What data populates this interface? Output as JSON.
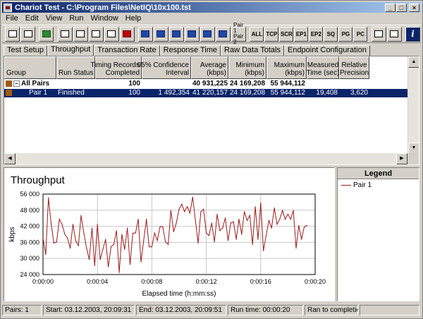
{
  "window": {
    "title": "Chariot Test - C:\\Program Files\\NetIQ\\10x100.tst"
  },
  "title_buttons": {
    "minimize": "_",
    "maximize": "□",
    "close": "×"
  },
  "menu": [
    "File",
    "Edit",
    "View",
    "Run",
    "Window",
    "Help"
  ],
  "toolbar": {
    "text_buttons": [
      "ALL",
      "TCP",
      "SCR",
      "EP1",
      "EP2",
      "SQ",
      "PG",
      "PC"
    ],
    "pair_label_1": "Pair 1",
    "pair_label_2": "Pair 2",
    "help": "i"
  },
  "tabs": [
    "Test Setup",
    "Throughput",
    "Transaction Rate",
    "Response Time",
    "Raw Data Totals",
    "Endpoint Configuration"
  ],
  "table": {
    "columns": [
      "Group",
      "Run Status",
      "Timing Records\nCompleted",
      "95% Confidence\nInterval",
      "Average\n(kbps)",
      "Minimum\n(kbps)",
      "Maximum\n(kbps)",
      "Measured\nTime (sec)",
      "Relative\nPrecision"
    ],
    "all_pairs": {
      "group": "All Pairs",
      "status": "",
      "records": "100",
      "confidence": "",
      "average": "40 931,225",
      "minimum": "24 169,208",
      "maximum": "55 944,112",
      "time": "",
      "precision": ""
    },
    "rows": [
      {
        "group": "Pair 1",
        "status": "Finished",
        "records": "100",
        "confidence": "1 492,354",
        "average": "41 220,157",
        "minimum": "24 169,208",
        "maximum": "55 944,112",
        "time": "19,408",
        "precision": "3,620"
      }
    ]
  },
  "chart_data": {
    "type": "line",
    "title": "Throughput",
    "xlabel": "Elapsed time (h:mm:ss)",
    "ylabel": "kbps",
    "xlim": [
      0,
      20
    ],
    "ylim": [
      24000,
      56000
    ],
    "xticks": [
      "0:00:00",
      "0:00:04",
      "0:00:08",
      "0:00:12",
      "0:00:16",
      "0:00:20"
    ],
    "yticks": [
      "24 000",
      "30 000",
      "36 000",
      "42 000",
      "48 000",
      "56 000"
    ],
    "grid": true,
    "series": [
      {
        "name": "Pair 1",
        "color": "#9b1b1b",
        "x": [
          0.0,
          0.2,
          0.4,
          0.6,
          0.8,
          1.0,
          1.2,
          1.4,
          1.6,
          1.8,
          2.0,
          2.2,
          2.4,
          2.6,
          2.8,
          3.0,
          3.2,
          3.4,
          3.6,
          3.8,
          4.0,
          4.2,
          4.4,
          4.6,
          4.8,
          5.0,
          5.2,
          5.4,
          5.6,
          5.8,
          6.0,
          6.2,
          6.4,
          6.6,
          6.8,
          7.0,
          7.2,
          7.4,
          7.6,
          7.8,
          8.0,
          8.2,
          8.4,
          8.6,
          8.8,
          9.0,
          9.2,
          9.4,
          9.6,
          9.8,
          10.0,
          10.2,
          10.4,
          10.6,
          10.8,
          11.0,
          11.2,
          11.4,
          11.6,
          11.8,
          12.0,
          12.2,
          12.4,
          12.6,
          12.8,
          13.0,
          13.2,
          13.4,
          13.6,
          13.8,
          14.0,
          14.2,
          14.4,
          14.6,
          14.8,
          15.0,
          15.2,
          15.4,
          15.6,
          15.8,
          16.0,
          16.2,
          16.4,
          16.6,
          16.8,
          17.0,
          17.2,
          17.4,
          17.6,
          17.8,
          18.0,
          18.2,
          18.4,
          18.6,
          18.8,
          19.0,
          19.2,
          19.4
        ],
        "values": [
          38500,
          32000,
          54500,
          44000,
          36500,
          37000,
          46000,
          44000,
          40000,
          38500,
          34500,
          44000,
          37500,
          35500,
          47500,
          40500,
          34500,
          30000,
          42500,
          27500,
          44000,
          30000,
          34000,
          38000,
          27000,
          35000,
          36000,
          41500,
          24800,
          40000,
          34000,
          42500,
          28000,
          40500,
          40500,
          46000,
          29000,
          37500,
          46000,
          35000,
          35000,
          40500,
          37500,
          43000,
          43000,
          37000,
          36000,
          49500,
          41000,
          44500,
          50000,
          52000,
          49000,
          51000,
          48500,
          54800,
          45500,
          36500,
          49000,
          50000,
          40500,
          39500,
          44500,
          37000,
          48000,
          41500,
          42500,
          46500,
          37500,
          44500,
          45000,
          38000,
          46000,
          40000,
          49000,
          45500,
          47500,
          36000,
          51000,
          38000,
          52500,
          33500,
          39500,
          45500,
          42500,
          50500,
          44000,
          46000,
          49500,
          46000,
          48000,
          46000,
          49500,
          34500,
          43500,
          38000,
          43000,
          43500
        ]
      }
    ]
  },
  "legend": {
    "title": "Legend",
    "items": [
      "Pair 1"
    ]
  },
  "status": {
    "pairs": "Pairs: 1",
    "start": "Start: 03.12.2003, 20:09:31",
    "end": "End: 03.12.2003, 20:09:51",
    "runtime": "Run time: 00:00:20",
    "state": "Ran to completion"
  }
}
